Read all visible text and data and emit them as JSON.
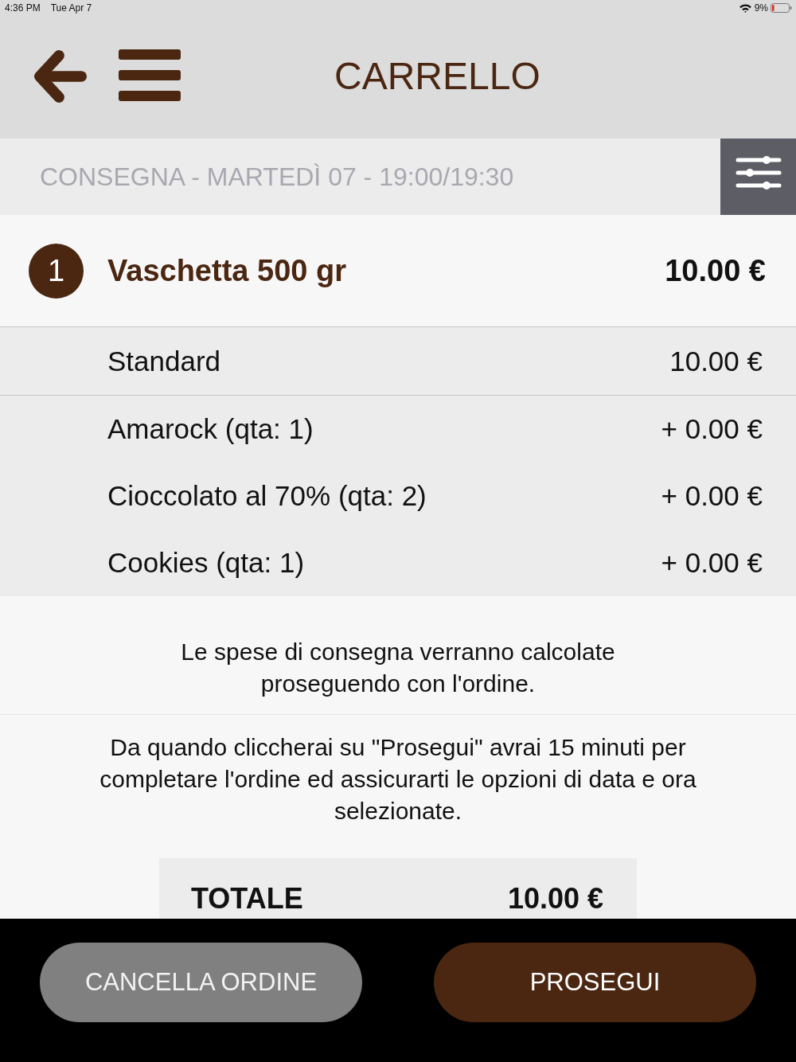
{
  "status_bar": {
    "time": "4:36 PM",
    "date": "Tue Apr 7",
    "battery": "9%"
  },
  "header": {
    "title": "CARRELLO"
  },
  "delivery": {
    "text": "CONSEGNA - MARTEDÌ 07 - 19:00/19:30"
  },
  "cart_items": [
    {
      "quantity": "1",
      "name": "Vaschetta 500 gr",
      "price": "10.00 €",
      "lines": [
        {
          "kind": "base",
          "label": "Standard",
          "price": "10.00 €"
        },
        {
          "kind": "extra",
          "label": "Amarock (qta: 1)",
          "price": "+ 0.00 €"
        },
        {
          "kind": "extra",
          "label": "Cioccolato al 70% (qta: 2)",
          "price": "+ 0.00 €"
        },
        {
          "kind": "extra",
          "label": "Cookies (qta: 1)",
          "price": "+ 0.00 €"
        }
      ]
    }
  ],
  "notes": [
    "Le spese di consegna verranno calcolate\nproseguendo con l'ordine.",
    "Da quando cliccherai su \"Prosegui\" avrai 15 minuti per\ncompletare l'ordine ed assicurarti le opzioni di data e ora\nselezionate."
  ],
  "total": {
    "label": "TOTALE",
    "value": "10.00 €"
  },
  "buttons": [
    {
      "kind": "secondary",
      "label": "CANCELLA ORDINE"
    },
    {
      "kind": "primary",
      "label": "PROSEGUI"
    }
  ]
}
